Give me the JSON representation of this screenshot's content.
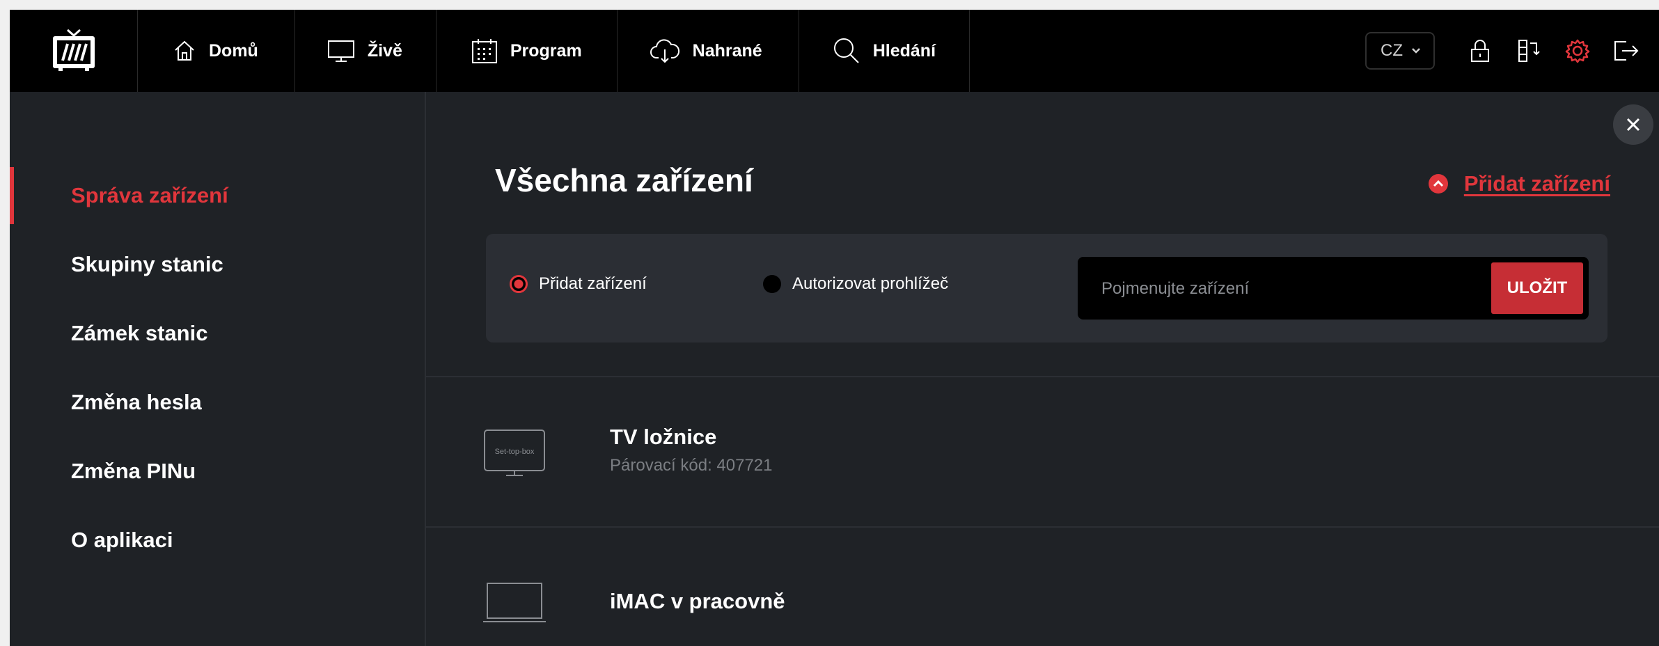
{
  "nav": {
    "items": [
      {
        "label": "Domů",
        "icon": "home-icon"
      },
      {
        "label": "Živě",
        "icon": "monitor-icon"
      },
      {
        "label": "Program",
        "icon": "calendar-icon"
      },
      {
        "label": "Nahrané",
        "icon": "cloud-download-icon"
      },
      {
        "label": "Hledání",
        "icon": "search-icon"
      }
    ],
    "language": "CZ",
    "right_icons": [
      "lock-icon",
      "devices-switch-icon",
      "gear-icon",
      "logout-icon"
    ]
  },
  "sidebar": {
    "items": [
      {
        "label": "Správa zařízení",
        "active": true
      },
      {
        "label": "Skupiny stanic",
        "active": false
      },
      {
        "label": "Zámek stanic",
        "active": false
      },
      {
        "label": "Změna hesla",
        "active": false
      },
      {
        "label": "Změna PINu",
        "active": false
      },
      {
        "label": "O aplikaci",
        "active": false
      }
    ]
  },
  "main": {
    "title": "Všechna zařízení",
    "add_link": "Přidat zařízení",
    "add_panel": {
      "option_add": "Přidat zařízení",
      "option_authorize": "Autorizovat prohlížeč",
      "selected": "option_add",
      "name_placeholder": "Pojmenujte zařízení",
      "name_value": "",
      "save_label": "ULOŽIT"
    },
    "devices": [
      {
        "name": "TV ložnice",
        "code_text": "Párovací kód: 407721",
        "icon": "set-top-box-icon",
        "icon_label": "Set-top-box"
      },
      {
        "name": "iMAC v pracovně",
        "code_text": "",
        "icon": "laptop-icon"
      }
    ]
  },
  "colors": {
    "accent": "#e1363c",
    "background": "#1f2226",
    "topbar": "#000000",
    "panel": "#2b2e34"
  }
}
